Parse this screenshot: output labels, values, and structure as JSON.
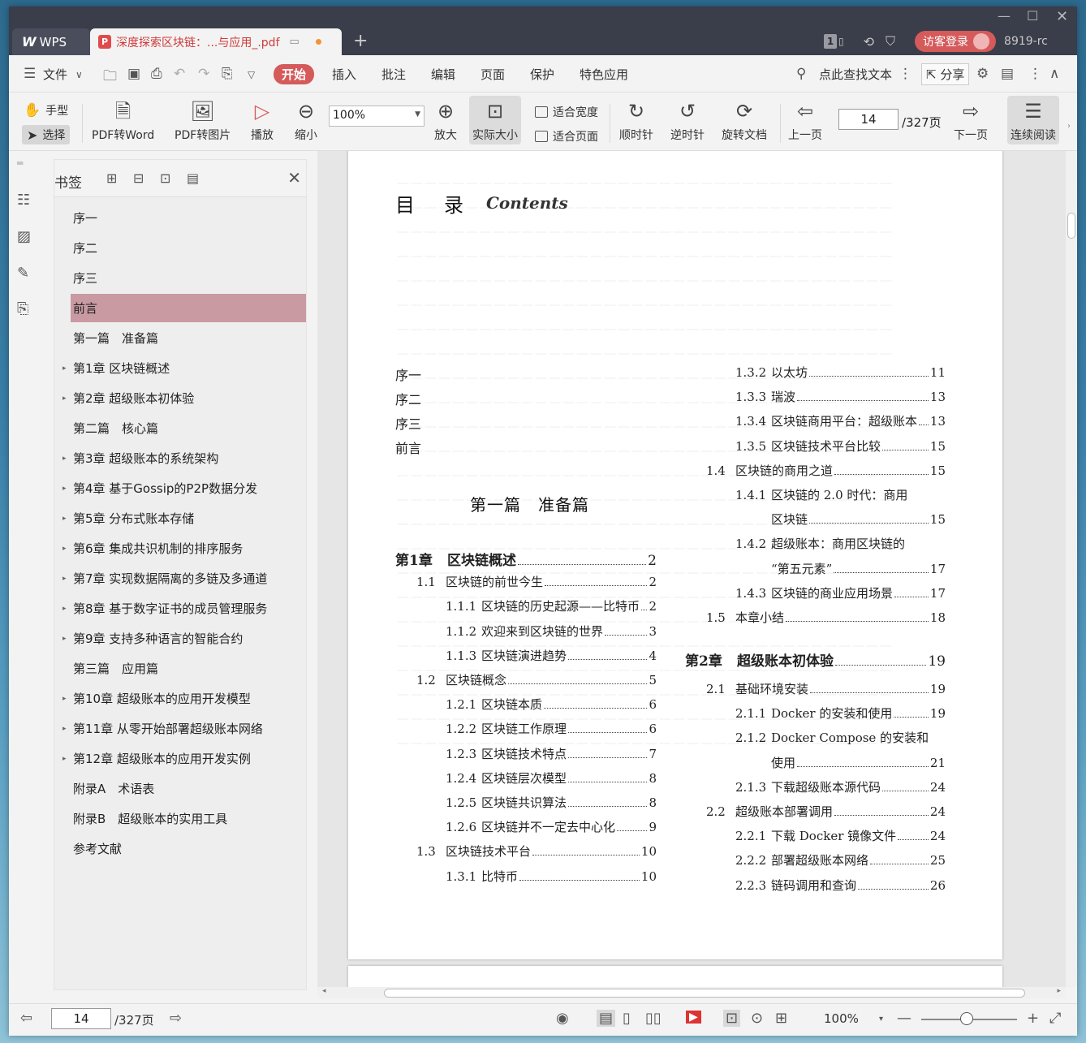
{
  "titlebar": {
    "app_name": "WPS",
    "doc_tab_title": "深度探索区块链：...与应用_.pdf",
    "new_tab": "+",
    "badge": "1",
    "login_label": "访客登录",
    "user_id": "8919-rc"
  },
  "menubar": {
    "file": "文件",
    "items": [
      "开始",
      "插入",
      "批注",
      "编辑",
      "页面",
      "保护",
      "特色应用"
    ],
    "search": "点此查找文本",
    "share": "分享"
  },
  "toolbar": {
    "hand": "手型",
    "select": "选择",
    "pdf_word": "PDF转Word",
    "pdf_image": "PDF转图片",
    "play": "播放",
    "zoom_out": "缩小",
    "zoom_value": "100%",
    "zoom_in": "放大",
    "actual_size": "实际大小",
    "fit_width": "适合宽度",
    "fit_page": "适合页面",
    "clockwise": "顺时针",
    "counter_clockwise": "逆时针",
    "rotate_doc": "旋转文档",
    "prev_page": "上一页",
    "page_current": "14",
    "page_total": "/327页",
    "next_page": "下一页",
    "continuous": "连续阅读"
  },
  "bookmark": {
    "title": "书签",
    "items": [
      {
        "label": "序一",
        "expandable": false
      },
      {
        "label": "序二",
        "expandable": false
      },
      {
        "label": "序三",
        "expandable": false
      },
      {
        "label": "前言",
        "expandable": false,
        "active": true
      },
      {
        "label": "第一篇　准备篇",
        "expandable": false
      },
      {
        "label": "第1章 区块链概述",
        "expandable": true
      },
      {
        "label": "第2章 超级账本初体验",
        "expandable": true
      },
      {
        "label": "第二篇　核心篇",
        "expandable": false
      },
      {
        "label": "第3章 超级账本的系统架构",
        "expandable": true
      },
      {
        "label": "第4章 基于Gossip的P2P数据分发",
        "expandable": true
      },
      {
        "label": "第5章 分布式账本存储",
        "expandable": true
      },
      {
        "label": "第6章 集成共识机制的排序服务",
        "expandable": true
      },
      {
        "label": "第7章 实现数据隔离的多链及多通道",
        "expandable": true
      },
      {
        "label": "第8章 基于数字证书的成员管理服务",
        "expandable": true
      },
      {
        "label": "第9章 支持多种语言的智能合约",
        "expandable": true
      },
      {
        "label": "第三篇　应用篇",
        "expandable": false
      },
      {
        "label": "第10章 超级账本的应用开发模型",
        "expandable": true
      },
      {
        "label": "第11章 从零开始部署超级账本网络",
        "expandable": true
      },
      {
        "label": "第12章 超级账本的应用开发实例",
        "expandable": true
      },
      {
        "label": "附录A　术语表",
        "expandable": false
      },
      {
        "label": "附录B　超级账本的实用工具",
        "expandable": false
      },
      {
        "label": "参考文献",
        "expandable": false
      }
    ]
  },
  "page": {
    "heading": "目　录",
    "heading_en": "Contents",
    "front": [
      "序一",
      "序二",
      "序三",
      "前言"
    ],
    "part1": "第一篇　准备篇",
    "left_toc": [
      {
        "num": "第1章",
        "title": "区块链概述",
        "page": "2",
        "level": 0
      },
      {
        "num": "1.1",
        "title": "区块链的前世今生",
        "page": "2",
        "level": 1
      },
      {
        "num": "1.1.1",
        "title": "区块链的历史起源——比特币",
        "page": "2",
        "level": 2
      },
      {
        "num": "1.1.2",
        "title": "欢迎来到区块链的世界",
        "page": "3",
        "level": 2
      },
      {
        "num": "1.1.3",
        "title": "区块链演进趋势",
        "page": "4",
        "level": 2
      },
      {
        "num": "1.2",
        "title": "区块链概念",
        "page": "5",
        "level": 1
      },
      {
        "num": "1.2.1",
        "title": "区块链本质",
        "page": "6",
        "level": 2
      },
      {
        "num": "1.2.2",
        "title": "区块链工作原理",
        "page": "6",
        "level": 2
      },
      {
        "num": "1.2.3",
        "title": "区块链技术特点",
        "page": "7",
        "level": 2
      },
      {
        "num": "1.2.4",
        "title": "区块链层次模型",
        "page": "8",
        "level": 2
      },
      {
        "num": "1.2.5",
        "title": "区块链共识算法",
        "page": "8",
        "level": 2
      },
      {
        "num": "1.2.6",
        "title": "区块链并不一定去中心化",
        "page": "9",
        "level": 2
      },
      {
        "num": "1.3",
        "title": "区块链技术平台",
        "page": "10",
        "level": 1
      },
      {
        "num": "1.3.1",
        "title": "比特币",
        "page": "10",
        "level": 2
      }
    ],
    "right_toc": [
      {
        "num": "1.3.2",
        "title": "以太坊",
        "page": "11",
        "level": 2
      },
      {
        "num": "1.3.3",
        "title": "瑞波",
        "page": "13",
        "level": 2
      },
      {
        "num": "1.3.4",
        "title": "区块链商用平台：超级账本",
        "page": "13",
        "level": 2
      },
      {
        "num": "1.3.5",
        "title": "区块链技术平台比较",
        "page": "15",
        "level": 2
      },
      {
        "num": "1.4",
        "title": "区块链的商用之道",
        "page": "15",
        "level": 1
      },
      {
        "num": "1.4.1",
        "title": "区块链的 2.0 时代：商用",
        "page": "",
        "level": 2
      },
      {
        "num": "",
        "title": "区块链",
        "page": "15",
        "level": 3
      },
      {
        "num": "1.4.2",
        "title": "超级账本：商用区块链的",
        "page": "",
        "level": 2
      },
      {
        "num": "",
        "title": "“第五元素”",
        "page": "17",
        "level": 3
      },
      {
        "num": "1.4.3",
        "title": "区块链的商业应用场景",
        "page": "17",
        "level": 2
      },
      {
        "num": "1.5",
        "title": "本章小结",
        "page": "18",
        "level": 1
      },
      {
        "num": "第2章",
        "title": "超级账本初体验",
        "page": "19",
        "level": 0
      },
      {
        "num": "2.1",
        "title": "基础环境安装",
        "page": "19",
        "level": 1
      },
      {
        "num": "2.1.1",
        "title": "Docker 的安装和使用",
        "page": "19",
        "level": 2
      },
      {
        "num": "2.1.2",
        "title": "Docker Compose 的安装和",
        "page": "",
        "level": 2
      },
      {
        "num": "",
        "title": "使用",
        "page": "21",
        "level": 3
      },
      {
        "num": "2.1.3",
        "title": "下载超级账本源代码",
        "page": "24",
        "level": 2
      },
      {
        "num": "2.2",
        "title": "超级账本部署调用",
        "page": "24",
        "level": 1
      },
      {
        "num": "2.2.1",
        "title": "下载 Docker 镜像文件",
        "page": "24",
        "level": 2
      },
      {
        "num": "2.2.2",
        "title": "部署超级账本网络",
        "page": "25",
        "level": 2
      },
      {
        "num": "2.2.3",
        "title": "链码调用和查询",
        "page": "26",
        "level": 2
      }
    ]
  },
  "statusbar": {
    "page_current": "14",
    "page_total": "/327页",
    "zoom": "100%"
  }
}
